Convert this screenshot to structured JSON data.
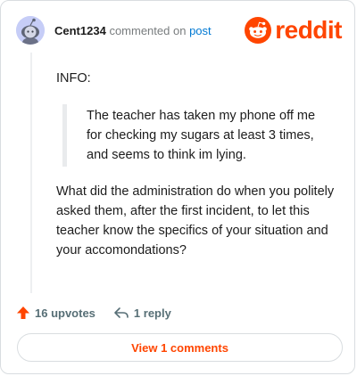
{
  "header": {
    "username": "Cent1234",
    "commented_text": "commented on",
    "post_link": "post",
    "brand": "reddit",
    "brand_color": "#ff4500"
  },
  "comment": {
    "info_label": "INFO:",
    "quote_lines": [
      "The teacher has taken my phone off me",
      "for checking my sugars at least 3 times,",
      "and seems to think im lying."
    ],
    "body_lines": [
      "What did the administration do when you politely",
      "asked them, after the first incident, to let this",
      "teacher know the specifics of your situation and",
      "your accomondations?"
    ]
  },
  "actions": {
    "upvotes": "16 upvotes",
    "replies": "1 reply"
  },
  "view_comments_button": "View 1 comments",
  "icons": [
    "reddit-avatar-icon",
    "reddit-logo-icon",
    "upvote-arrow-icon",
    "reply-arrow-icon"
  ]
}
